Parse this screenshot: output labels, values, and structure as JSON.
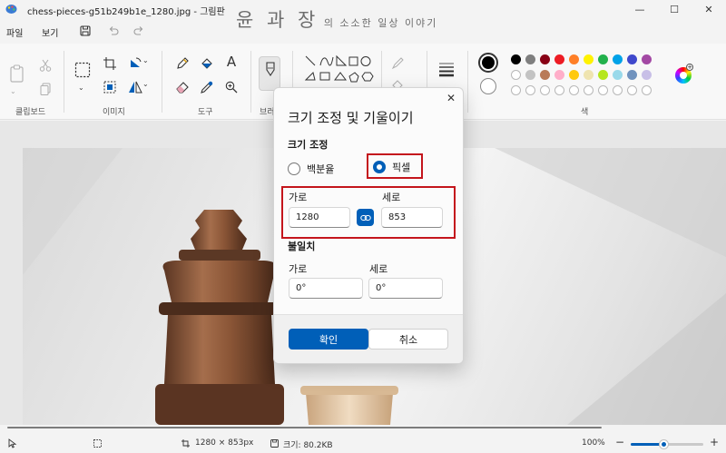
{
  "window": {
    "title": "chess-pieces-g51b249b1e_1280.jpg - 그림판",
    "watermark_big": "윤 과 장",
    "watermark_small": "의 소소한 일상 이야기",
    "controls": {
      "minimize": "—",
      "maximize": "☐",
      "close": "✕"
    }
  },
  "menu": {
    "file": "파일",
    "view": "보기"
  },
  "ribbon": {
    "groups": {
      "clipboard": "클립보드",
      "image": "이미지",
      "tools": "도구",
      "brush": "브러",
      "colors": "색"
    },
    "text_tool_glyph": "A",
    "colors": {
      "current_primary": "#000000",
      "current_secondary": "#ffffff",
      "row1": [
        "#000000",
        "#7f7f7f",
        "#880015",
        "#ed1c24",
        "#ff7f27",
        "#fff200",
        "#22b14c",
        "#00a2e8",
        "#3f48cc",
        "#a349a4"
      ],
      "row2": [
        "#ffffff",
        "#c3c3c3",
        "#b97a57",
        "#ffaec9",
        "#ffc90e",
        "#efe4b0",
        "#b5e61d",
        "#99d9ea",
        "#7092be",
        "#c8bfe7"
      ]
    }
  },
  "dialog": {
    "title": "크기 조정 및 기울이기",
    "resize_section": "크기 조정",
    "percent_label": "백분율",
    "pixel_label": "픽셀",
    "width_label": "가로",
    "height_label": "세로",
    "width_value": "1280",
    "height_value": "853",
    "skew_section": "불일치",
    "skew_h_label": "가로",
    "skew_v_label": "세로",
    "skew_h_value": "0°",
    "skew_v_value": "0°",
    "ok_label": "확인",
    "cancel_label": "취소"
  },
  "status": {
    "dimensions": "1280 × 853px",
    "file_size": "크기: 80.2KB",
    "zoom": "100%",
    "zoom_level": 0.45
  }
}
